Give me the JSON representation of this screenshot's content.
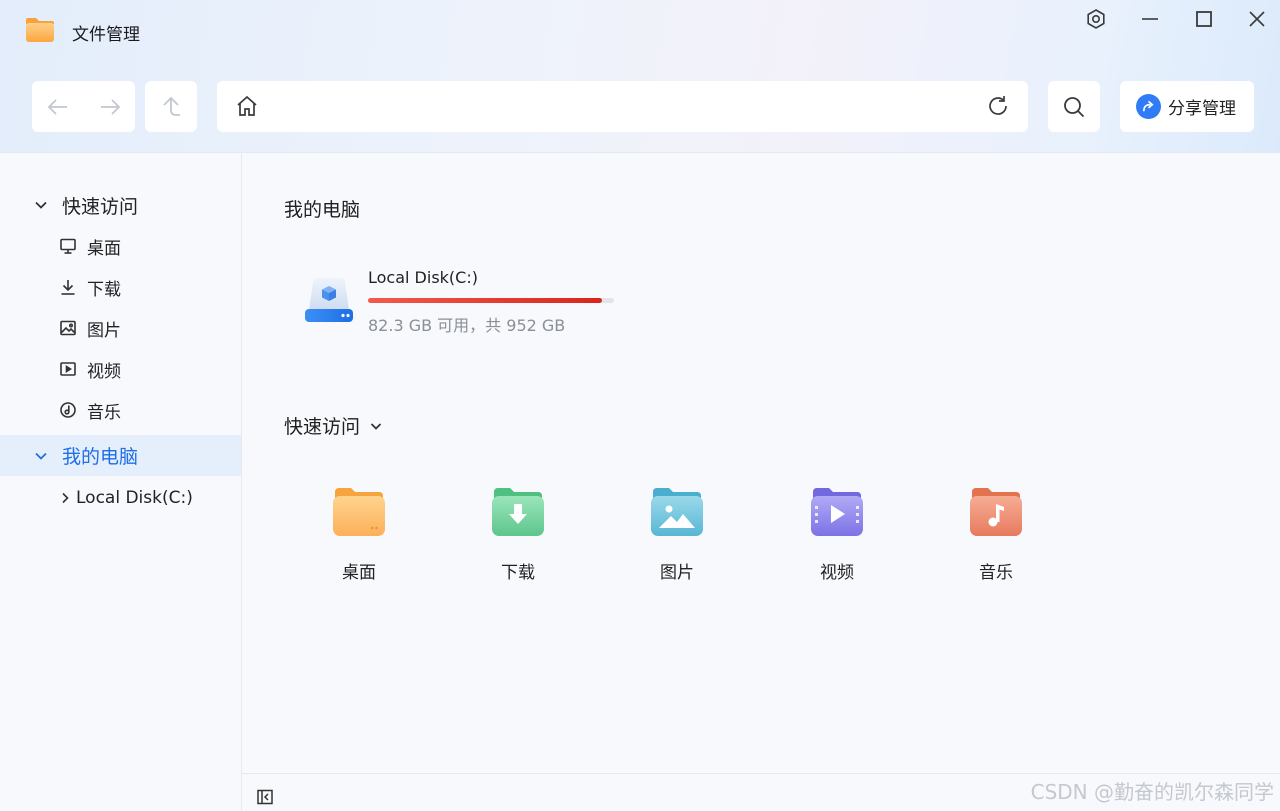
{
  "window": {
    "title": "文件管理",
    "controls": [
      "settings-icon",
      "minimize-icon",
      "maximize-icon",
      "close-icon"
    ]
  },
  "toolbar": {
    "back_icon": "arrow-left-icon",
    "forward_icon": "arrow-right-icon",
    "up_icon": "arrow-up-icon",
    "address_icon": "home-icon",
    "address_value": "",
    "refresh_icon": "refresh-icon",
    "search_icon": "search-icon",
    "share_label": "分享管理"
  },
  "sidebar": {
    "quick_access": {
      "label": "快速访问",
      "items": [
        {
          "label": "桌面",
          "icon": "monitor-icon"
        },
        {
          "label": "下载",
          "icon": "download-icon"
        },
        {
          "label": "图片",
          "icon": "image-icon"
        },
        {
          "label": "视频",
          "icon": "video-icon"
        },
        {
          "label": "音乐",
          "icon": "music-icon"
        }
      ]
    },
    "my_computer": {
      "label": "我的电脑",
      "selected": true,
      "items": [
        {
          "label": "Local Disk(C:)",
          "icon": "chevron-right-icon"
        }
      ]
    }
  },
  "main": {
    "computer_section": {
      "title": "我的电脑",
      "disks": [
        {
          "name": "Local Disk(C:)",
          "free_text": "82.3 GB 可用，共 952 GB",
          "used_fraction": 0.951,
          "bar_color": "#e2352b"
        }
      ]
    },
    "quick_access_section": {
      "title": "快速访问",
      "tiles": [
        {
          "label": "桌面",
          "icon": "desktop-folder-icon",
          "color": "#fcb760"
        },
        {
          "label": "下载",
          "icon": "download-folder-icon",
          "color": "#6fd29b"
        },
        {
          "label": "图片",
          "icon": "pictures-folder-icon",
          "color": "#6cc3dd"
        },
        {
          "label": "视频",
          "icon": "videos-folder-icon",
          "color": "#8b83ee"
        },
        {
          "label": "音乐",
          "icon": "music-folder-icon",
          "color": "#ef8a6e"
        }
      ]
    }
  },
  "footer": {
    "collapse_icon": "collapse-sidebar-icon",
    "watermark": "CSDN @勤奋的凯尔森同学"
  },
  "colors": {
    "accent": "#1f6fe6",
    "share": "#2f7cf6",
    "selected_bg": "#e5eefb"
  }
}
